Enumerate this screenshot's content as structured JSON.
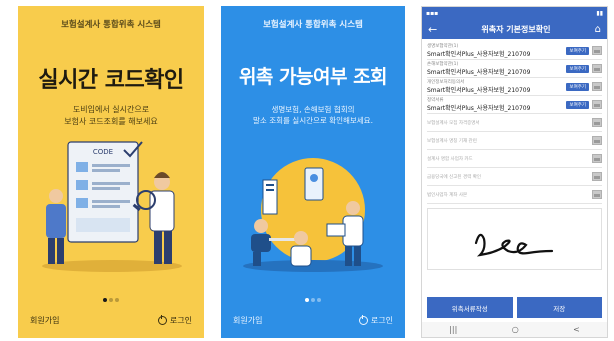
{
  "screen1": {
    "app_title": "보험설계사 통합위촉 시스템",
    "headline": "실시간 코드확인",
    "subtitle_line1": "도비입에서 실시간으로",
    "subtitle_line2": "보험사 코드조회를 해보세요",
    "illustration_label": "CODE",
    "dots": [
      true,
      false,
      false
    ],
    "signup_label": "회원가입",
    "login_label": "로그인"
  },
  "screen2": {
    "app_title": "보험설계사 통합위촉 시스템",
    "headline": "위촉 가능여부 조회",
    "subtitle_line1": "생명보험, 손해보험 협회의",
    "subtitle_line2": "말소 조회를 실시간으로 확인해보세요.",
    "dots": [
      true,
      false,
      false
    ],
    "signup_label": "회원가입",
    "login_label": "로그인"
  },
  "screen3": {
    "status_time": "",
    "title": "위촉자 기본정보확인",
    "back_icon": "arrow-left-icon",
    "home_icon": "home-icon",
    "fields": [
      {
        "small": "생명보험약관(1)",
        "value": "Smart확인서Plus_사용자보험_210709",
        "tag": "보여주기"
      },
      {
        "small": "손해보험약관(1)",
        "value": "Smart확인서Plus_사용자보험_210709",
        "tag": "보여주기"
      },
      {
        "small": "개인정보처리동의서",
        "value": "Smart확인서Plus_사용자보험_210709",
        "tag": "보여주기"
      },
      {
        "small": "청약서류",
        "value": "Smart확인서Plus_사용자보험_210709",
        "tag": "보여주기"
      },
      {
        "small": "",
        "value": "보험설계사 모집 자격증명서",
        "tag": ""
      },
      {
        "small": "",
        "value": "보험설계사 명칭 기재 관련",
        "tag": ""
      },
      {
        "small": "",
        "value": "설계사 명함 사업자 카드",
        "tag": ""
      },
      {
        "small": "",
        "value": "금융당국에 신고된 경력 확인",
        "tag": ""
      },
      {
        "small": "",
        "value": "법인사업자 계좌 사본",
        "tag": ""
      }
    ],
    "btn_left": "위촉서류작성",
    "btn_right": "저장",
    "nav": [
      "|||",
      "○",
      "<"
    ]
  },
  "colors": {
    "yellow": "#f8cc4c",
    "blue": "#2d8fe6",
    "header_blue": "#3b69c2"
  }
}
